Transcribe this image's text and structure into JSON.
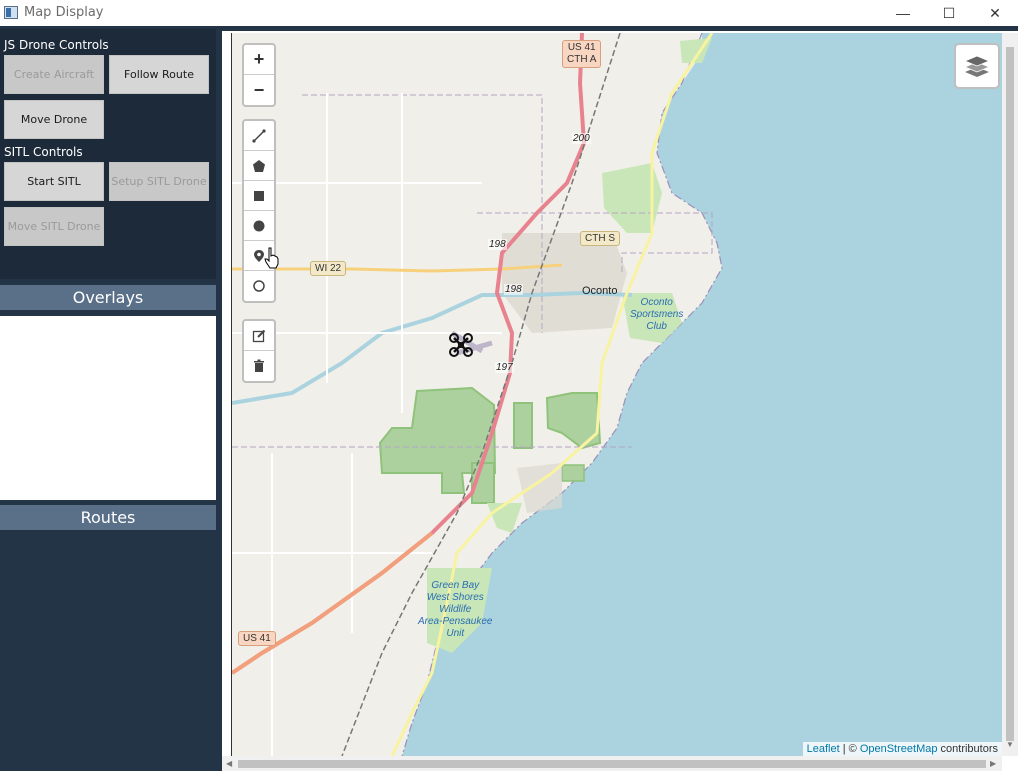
{
  "window": {
    "title": "Map Display",
    "minimize": "—",
    "maximize": "☐",
    "close": "✕"
  },
  "sidebar": {
    "js_section_label": "JS Drone Controls",
    "create_aircraft": "Create Aircraft",
    "follow_route": "Follow Route",
    "move_drone": "Move Drone",
    "sitl_section_label": "SITL Controls",
    "start_sitl": "Start SITL",
    "setup_sitl_drone": "Setup SITL Drone",
    "move_sitl_drone": "Move SITL Drone",
    "overlays_header": "Overlays",
    "routes_header": "Routes"
  },
  "map": {
    "zoom_in": "+",
    "zoom_out": "−",
    "labels": {
      "us41_cth_a_1": "US 41",
      "us41_cth_a_2": "CTH A",
      "route_200": "200",
      "route_198a": "198",
      "route_198b": "198",
      "route_197": "197",
      "wi22": "WI 22",
      "cth_s": "CTH S",
      "oconto": "Oconto",
      "oconto_club_1": "Oconto",
      "oconto_club_2": "Sportsmens",
      "oconto_club_3": "Club",
      "greenbay_1": "Green Bay",
      "greenbay_2": "West Shores",
      "greenbay_3": "Wildlife",
      "greenbay_4": "Area-Pensaukee",
      "greenbay_5": "Unit",
      "us41_bottom": "US 41"
    },
    "attribution": {
      "leaflet": "Leaflet",
      "sep": " | © ",
      "osm": "OpenStreetMap",
      "rest": " contributors"
    }
  },
  "colors": {
    "sidebar_bg": "#243447",
    "header_bar": "#5a6f88",
    "water": "#aad3df",
    "park": "#8fc27a",
    "highway": "#e8828f"
  }
}
